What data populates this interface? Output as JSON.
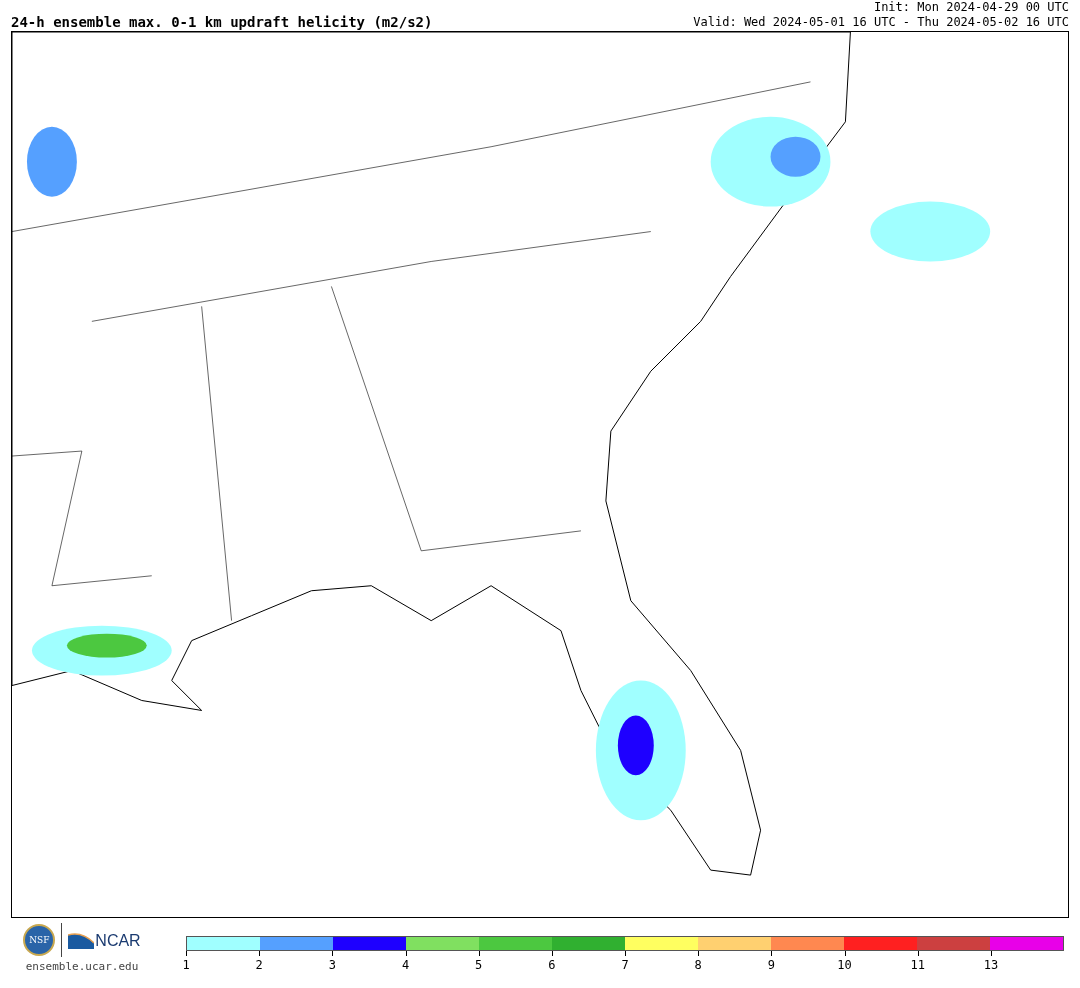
{
  "title": "24-h ensemble max. 0-1 km updraft helicity (m2/s2)",
  "init": "Init: Mon 2024-04-29 00 UTC",
  "valid": "Valid: Wed 2024-05-01 16 UTC - Thu 2024-05-02 16 UTC",
  "logos": {
    "nsf": "NSF",
    "ncar": "NCAR",
    "url": "ensemble.ucar.edu"
  },
  "colorbar": {
    "segments": [
      {
        "color": "#a0ffff"
      },
      {
        "color": "#55a0ff"
      },
      {
        "color": "#1e00ff"
      },
      {
        "color": "#80e060"
      },
      {
        "color": "#4cc840"
      },
      {
        "color": "#30b030"
      },
      {
        "color": "#ffff60"
      },
      {
        "color": "#ffd070"
      },
      {
        "color": "#ff8850"
      },
      {
        "color": "#ff2020"
      },
      {
        "color": "#cc4040"
      },
      {
        "color": "#e800e8"
      }
    ],
    "ticks": [
      "1",
      "2",
      "3",
      "4",
      "5",
      "6",
      "7",
      "8",
      "9",
      "10",
      "11",
      "13"
    ]
  }
}
